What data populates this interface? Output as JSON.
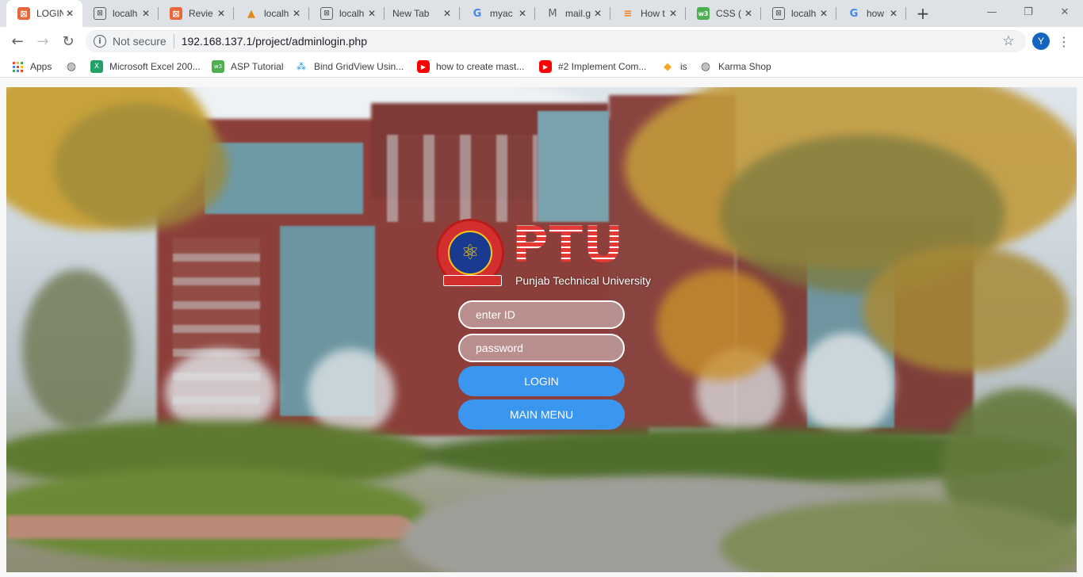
{
  "tabs": [
    {
      "title": "LOGIN",
      "icon": "xampp-icon",
      "active": true
    },
    {
      "title": "localh",
      "icon": "localhost-icon"
    },
    {
      "title": "Revie",
      "icon": "xampp-icon"
    },
    {
      "title": "localh",
      "icon": "phpmyadmin-icon"
    },
    {
      "title": "localh",
      "icon": "localhost-icon"
    },
    {
      "title": "New Tab",
      "icon": ""
    },
    {
      "title": "myac",
      "icon": "google-icon"
    },
    {
      "title": "mail.g",
      "icon": "gmail-icon"
    },
    {
      "title": "How t",
      "icon": "stackoverflow-icon"
    },
    {
      "title": "CSS (",
      "icon": "w3schools-icon"
    },
    {
      "title": "localh",
      "icon": "localhost-icon"
    },
    {
      "title": "how t",
      "icon": "google-icon"
    }
  ],
  "address_bar": {
    "security_label": "Not secure",
    "url": "192.168.137.1/project/adminlogin.php"
  },
  "profile_initial": "Y",
  "bookmarks": [
    {
      "label": "Apps",
      "icon": "apps-icon"
    },
    {
      "label": "",
      "icon": "globe-icon"
    },
    {
      "label": "Microsoft Excel 200...",
      "icon": "excel-icon"
    },
    {
      "label": "ASP Tutorial",
      "icon": "w3schools-icon"
    },
    {
      "label": "Bind GridView Usin...",
      "icon": "grid-icon"
    },
    {
      "label": "how to create mast...",
      "icon": "youtube-icon"
    },
    {
      "label": "#2 Implement Com...",
      "icon": "youtube-icon"
    },
    {
      "label": "is",
      "icon": "tag-icon"
    },
    {
      "label": "Karma Shop",
      "icon": "globe-icon"
    }
  ],
  "page": {
    "logo_text": "PTU",
    "logo_subtitle": "Punjab Technical University",
    "id_placeholder": "enter ID",
    "password_placeholder": "password",
    "login_label": "LOGIN",
    "main_menu_label": "MAIN MENU",
    "button_color": "#3b96f0"
  }
}
